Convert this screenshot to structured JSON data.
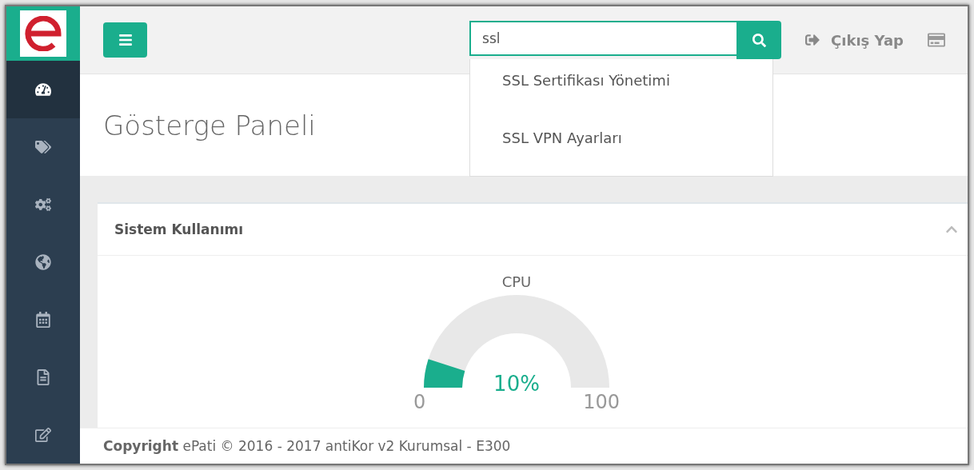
{
  "sidebar": {
    "items": [
      {
        "selected": true
      },
      {
        "selected": false
      },
      {
        "selected": false
      },
      {
        "selected": false
      },
      {
        "selected": false
      },
      {
        "selected": false
      },
      {
        "selected": false
      }
    ]
  },
  "header": {
    "search": {
      "value": "ssl",
      "suggestions": [
        "SSL Sertifikası Yönetimi",
        "SSL VPN Ayarları"
      ]
    },
    "logout": "Çıkış Yap"
  },
  "page_title": "Gösterge Paneli",
  "panel": {
    "title": "Sistem Kullanımı",
    "expanded": true,
    "gauge": {
      "title": "CPU",
      "level": 0.1,
      "reading": "10%",
      "min": "0",
      "max": "100"
    }
  },
  "footer": "**Copyright** ePati © 2016 - 2017  antiKor v2 Kurumsal - E300"
}
